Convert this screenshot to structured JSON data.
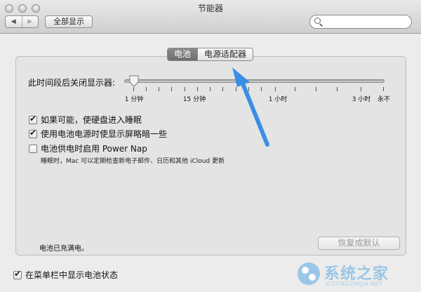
{
  "window": {
    "title": "节能器"
  },
  "toolbar": {
    "back_glyph": "◀",
    "forward_glyph": "▶",
    "show_all_label": "全部显示",
    "search_value": "",
    "search_placeholder": ""
  },
  "tabs": [
    {
      "label": "电池",
      "selected": true
    },
    {
      "label": "电源适配器",
      "selected": false
    }
  ],
  "display_sleep": {
    "label": "此时间段后关闭显示器:",
    "value": "2 分钟",
    "ticks": [
      "1 分钟",
      "15 分钟",
      "1 小时",
      "3 小时",
      "永不"
    ]
  },
  "options": [
    {
      "label": "如果可能，使硬盘进入睡眠",
      "checked": true
    },
    {
      "label": "使用电池电源时使显示屏略暗一些",
      "checked": true
    },
    {
      "label": "电池供电时启用 Power Nap",
      "checked": false
    }
  ],
  "power_nap_description": "睡眠时，Mac 可以定期检查新电子邮件、日历和其他 iCloud 更新",
  "battery_status": "电池已充满电。",
  "restore_default_label": "恢复成默认",
  "show_in_menubar": {
    "label": "在菜单栏中显示电池状态",
    "checked": true
  },
  "watermark": {
    "text": "系统之家",
    "sub": "XITONGZHIJIA.NET"
  },
  "colors": {
    "annotation_arrow": "#3a8ee6",
    "selected_tab": "#7a7a7a"
  }
}
